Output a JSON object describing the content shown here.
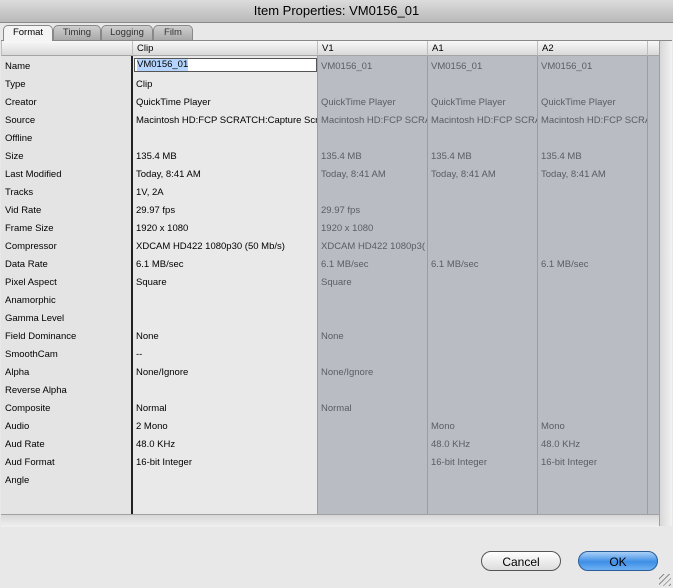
{
  "window": {
    "title": "Item Properties: VM0156_01"
  },
  "tabs": [
    {
      "label": "Format",
      "active": true
    },
    {
      "label": "Timing",
      "active": false
    },
    {
      "label": "Logging",
      "active": false
    },
    {
      "label": "Film",
      "active": false
    }
  ],
  "columns": {
    "clip": "Clip",
    "v1": "V1",
    "a1": "A1",
    "a2": "A2"
  },
  "rows": [
    "Name",
    "Type",
    "Creator",
    "Source",
    "Offline",
    "Size",
    "Last Modified",
    "Tracks",
    "Vid Rate",
    "Frame Size",
    "Compressor",
    "Data Rate",
    "Pixel Aspect",
    "Anamorphic",
    "Gamma Level",
    "Field Dominance",
    "SmoothCam",
    "Alpha",
    "Reverse Alpha",
    "Composite",
    "Audio",
    "Aud Rate",
    "Aud Format",
    "Angle"
  ],
  "clip_values": [
    "VM0156_01",
    "Clip",
    "QuickTime Player",
    "Macintosh HD:FCP SCRATCH:Capture Scra",
    "",
    "135.4 MB",
    "Today, 8:41 AM",
    "1V, 2A",
    "29.97 fps",
    "1920 x 1080",
    "XDCAM HD422 1080p30 (50 Mb/s)",
    "6.1 MB/sec",
    "Square",
    "",
    "",
    "None",
    "--",
    "None/Ignore",
    "",
    "Normal",
    "2 Mono",
    "48.0 KHz",
    "16-bit Integer",
    ""
  ],
  "v1_values": [
    "VM0156_01",
    "",
    "QuickTime Player",
    "Macintosh HD:FCP SCRATC",
    "",
    "135.4 MB",
    "Today, 8:41 AM",
    "",
    "29.97 fps",
    "1920 x 1080",
    "XDCAM HD422 1080p3(",
    "6.1 MB/sec",
    "Square",
    "",
    "",
    "None",
    "",
    "None/Ignore",
    "",
    "Normal",
    "",
    "",
    "",
    ""
  ],
  "a1_values": [
    "VM0156_01",
    "",
    "QuickTime Player",
    "Macintosh HD:FCP SCRATC",
    "",
    "135.4 MB",
    "Today, 8:41 AM",
    "",
    "",
    "",
    "",
    "6.1 MB/sec",
    "",
    "",
    "",
    "",
    "",
    "",
    "",
    "",
    "Mono",
    "48.0 KHz",
    "16-bit Integer",
    ""
  ],
  "a2_values": [
    "VM0156_01",
    "",
    "QuickTime Player",
    "Macintosh HD:FCP SCRATC",
    "",
    "135.4 MB",
    "Today, 8:41 AM",
    "",
    "",
    "",
    "",
    "6.1 MB/sec",
    "",
    "",
    "",
    "",
    "",
    "",
    "",
    "",
    "Mono",
    "48.0 KHz",
    "16-bit Integer",
    ""
  ],
  "buttons": {
    "cancel": "Cancel",
    "ok": "OK"
  }
}
